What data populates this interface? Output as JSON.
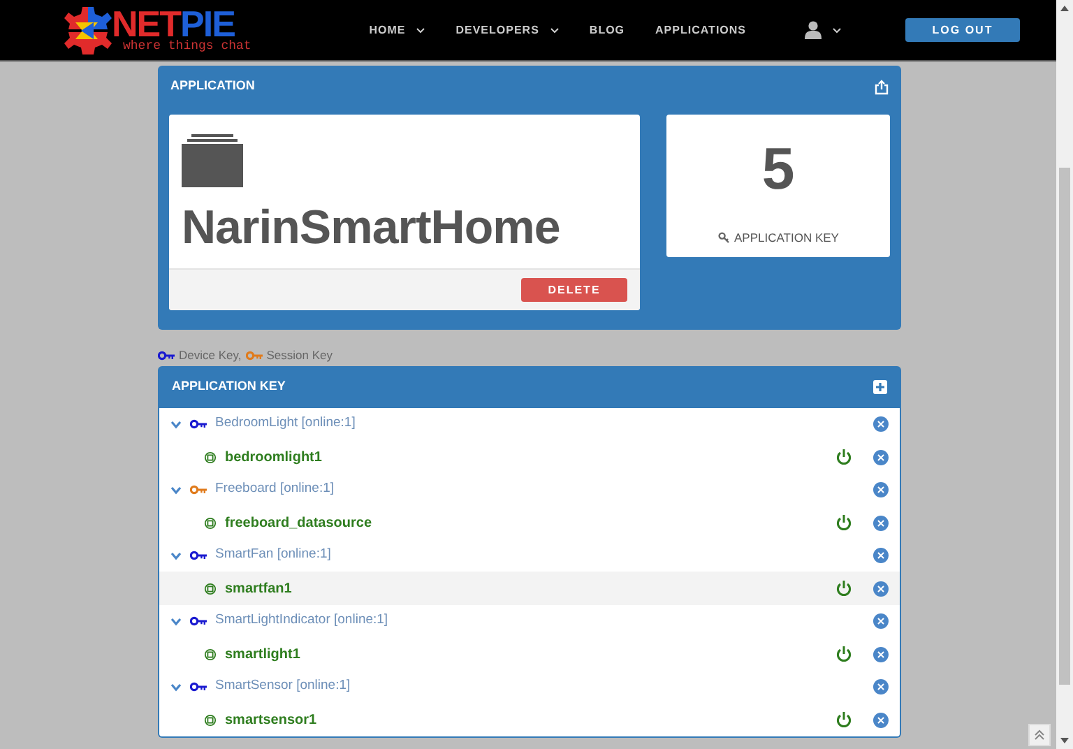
{
  "brand": {
    "word_1": "NET",
    "word_2": "PIE",
    "tagline": "where things chat"
  },
  "nav": [
    {
      "label": "HOME",
      "dropdown": true
    },
    {
      "label": "DEVELOPERS",
      "dropdown": true
    },
    {
      "label": "BLOG",
      "dropdown": false
    },
    {
      "label": "APPLICATIONS",
      "dropdown": false
    }
  ],
  "logout": "LOG OUT",
  "application": {
    "header": "APPLICATION",
    "name": "NarinSmartHome",
    "delete": "DELETE",
    "key_count": "5",
    "key_label": "APPLICATION KEY"
  },
  "legend": {
    "device": "Device Key,",
    "session": "Session Key"
  },
  "keys_panel": {
    "header": "APPLICATION KEY",
    "keys": [
      {
        "name": "BedroomLight",
        "status": "[online:1]",
        "kind": "device",
        "expanded": true,
        "children": [
          {
            "name": "bedroomlight1",
            "online": true,
            "highlighted": false
          }
        ]
      },
      {
        "name": "Freeboard",
        "status": "[online:1]",
        "kind": "session",
        "expanded": true,
        "children": [
          {
            "name": "freeboard_datasource",
            "online": true,
            "highlighted": false
          }
        ]
      },
      {
        "name": "SmartFan",
        "status": "[online:1]",
        "kind": "device",
        "expanded": true,
        "children": [
          {
            "name": "smartfan1",
            "online": true,
            "highlighted": true
          }
        ]
      },
      {
        "name": "SmartLightIndicator",
        "status": "[online:1]",
        "kind": "device",
        "expanded": true,
        "children": [
          {
            "name": "smartlight1",
            "online": true,
            "highlighted": false
          }
        ]
      },
      {
        "name": "SmartSensor",
        "status": "[online:1]",
        "kind": "device",
        "expanded": true,
        "children": [
          {
            "name": "smartsensor1",
            "online": true,
            "highlighted": false
          }
        ]
      }
    ]
  }
}
